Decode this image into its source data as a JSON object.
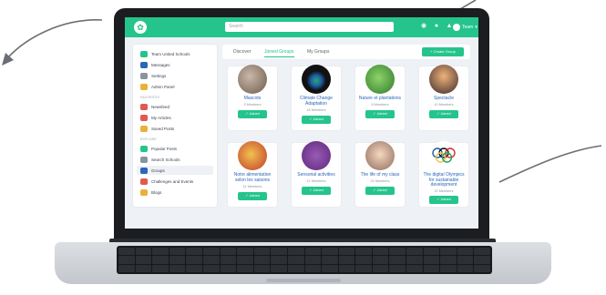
{
  "colors": {
    "brand": "#25c48c",
    "link": "#2b66b8",
    "background": "#eef1f5"
  },
  "header": {
    "search_placeholder": "Search",
    "icons": [
      "eye-icon",
      "chat-icon",
      "bell-icon"
    ],
    "user_label": "Team"
  },
  "sidebar": {
    "items_top": [
      {
        "label": "Team United Schools",
        "icon": "globe-icon"
      },
      {
        "label": "Messages",
        "icon": "chat-icon"
      },
      {
        "label": "Settings",
        "icon": "gear-icon"
      },
      {
        "label": "Admin Panel",
        "icon": "key-icon"
      }
    ],
    "section_favorites": "FAVORITES",
    "items_favorites": [
      {
        "label": "Newsfeed",
        "icon": "newspaper-icon"
      },
      {
        "label": "My Articles",
        "icon": "article-icon"
      },
      {
        "label": "Saved Posts",
        "icon": "bookmark-icon"
      }
    ],
    "section_explore": "EXPLORE",
    "items_explore": [
      {
        "label": "Popular Posts",
        "icon": "flame-icon"
      },
      {
        "label": "Search Schools",
        "icon": "search-icon"
      },
      {
        "label": "Groups",
        "icon": "groups-icon"
      },
      {
        "label": "Challenges and Events",
        "icon": "calendar-icon"
      },
      {
        "label": "Blogs",
        "icon": "blog-icon"
      }
    ]
  },
  "main": {
    "tabs": [
      {
        "label": "Discover"
      },
      {
        "label": "Joined Groups"
      },
      {
        "label": "My Groups"
      }
    ],
    "active_tab": "Joined Groups",
    "create_button": "+ Create Group",
    "joined_label": "✓ Joined",
    "groups": [
      {
        "name": "Mascots",
        "members": "3 Members"
      },
      {
        "name": "Climate Change Adaptation",
        "members": "18 Members"
      },
      {
        "name": "Nature et plantations",
        "members": "8 Members"
      },
      {
        "name": "Spectacle",
        "members": "10 Members"
      },
      {
        "name": "Notre alimentation selon les saisons",
        "members": "11 Members"
      },
      {
        "name": "Sensorial activities",
        "members": "12 Members"
      },
      {
        "name": "The life of my class",
        "members": "21 Members"
      },
      {
        "name": "The digital Olympics for sustainable development",
        "members": "22 Members"
      }
    ]
  }
}
